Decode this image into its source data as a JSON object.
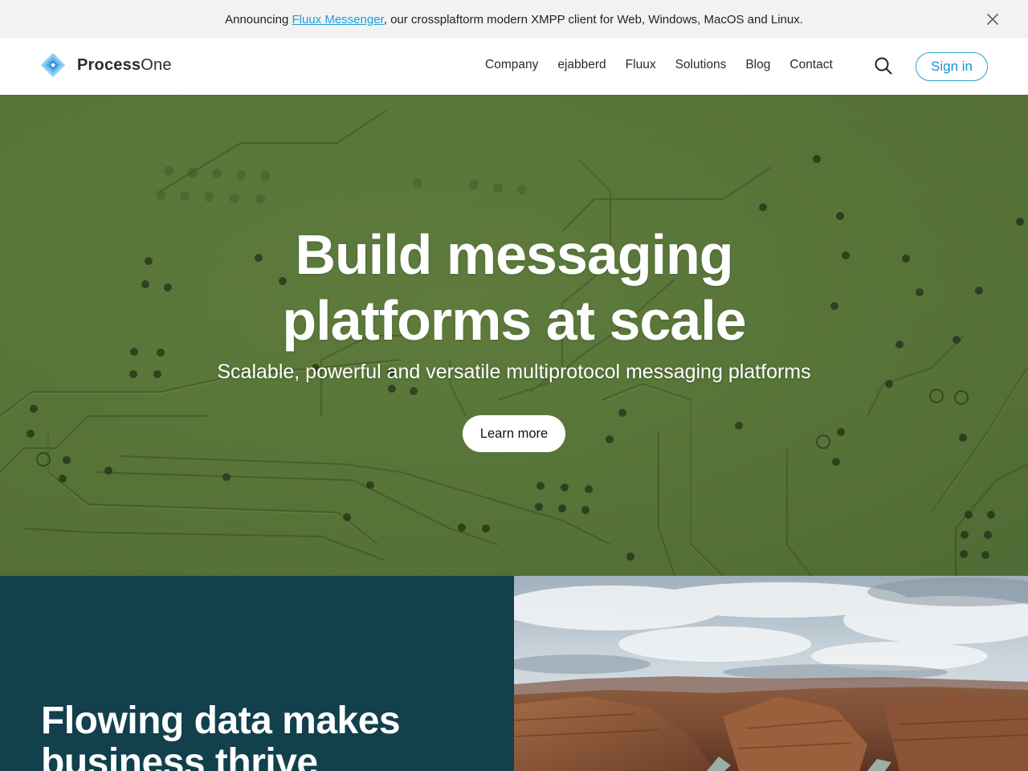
{
  "announcement": {
    "prefix": "Announcing ",
    "link_text": "Fluux Messenger",
    "suffix": ", our crossplaftorm modern XMPP client for Web, Windows, MacOS and Linux.",
    "close_icon": "close-icon"
  },
  "header": {
    "logo": {
      "strong": "Process",
      "light": "One"
    },
    "nav": [
      "Company",
      "ejabberd",
      "Fluux",
      "Solutions",
      "Blog",
      "Contact"
    ],
    "search_icon": "search-icon",
    "signin_label": "Sign in"
  },
  "hero": {
    "title_line1": "Build messaging",
    "title_line2": "platforms at scale",
    "subtitle": "Scalable, powerful and versatile multiprotocol messaging platforms",
    "cta_label": "Learn more"
  },
  "section": {
    "title_line1": "Flowing data makes",
    "title_line2": "business thrive"
  },
  "colors": {
    "accent": "#1a9ed9",
    "hero_green": "#5d7a3c",
    "panel_teal": "#12404d"
  }
}
